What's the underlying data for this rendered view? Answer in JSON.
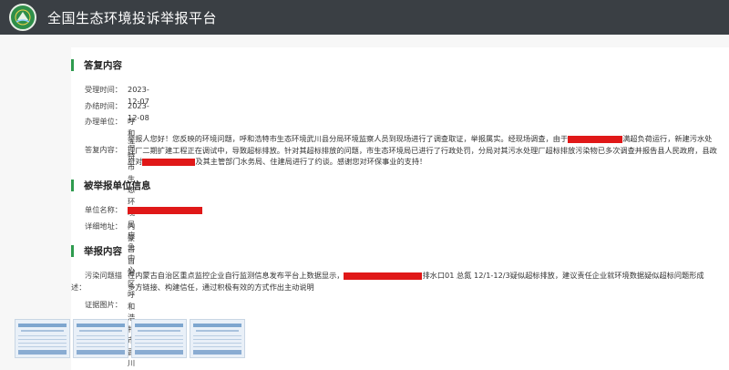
{
  "header": {
    "title": "全国生态环境投诉举报平台",
    "logo_icon": "emblem-icon"
  },
  "reply": {
    "heading": "答复内容",
    "accepted_label": "受理时间：",
    "accepted_value": "2023-12-07",
    "finished_label": "办结时间：",
    "finished_value": "2023-12-08",
    "unit_label": "办理单位：",
    "unit_value": "呼和浩特市生态环境局应急中心",
    "content_label": "答复内容：",
    "content_part1": "举报人您好！您反映的环境问题，呼和浩特市生态环境武川县分局环境监察人员到现场进行了调查取证，举报属实。经现场调查，由于",
    "content_part2": "满超负荷运行，新建污水处理厂二期扩建工程正在调试中，导致超标排放。针对其超标排放的问题，市生态环境局已进行了行政处罚，分局对其污水处理厂超标排放污染物已多次调查并报告县人民政府，县政府对",
    "content_part3": "及其主管部门水务局、住建局进行了约谈。感谢您对环保事业的支持！"
  },
  "reported": {
    "heading": "被举报单位信息",
    "name_label": "单位名称：",
    "address_label": "详细地址：",
    "address_value": "内蒙古自治区呼和浩特市武川县"
  },
  "report": {
    "heading": "举报内容",
    "problem_label_1": "污染问题描",
    "problem_label_2": "述：",
    "problem_part1": "在内蒙古自治区重点监控企业自行监测信息发布平台上数据显示，",
    "problem_part2": "排水口01 总氮 12/1-12/3疑似超标排放，建议责任企业就环境数据疑似超标问题形成",
    "problem_line2": "多方链接、构建信任，通过积极有效的方式作出主动说明",
    "evidence_label": "证据图片："
  },
  "colors": {
    "topbar": "#3a3f44",
    "accent": "#2e9b4e",
    "redaction": "#e01818"
  }
}
